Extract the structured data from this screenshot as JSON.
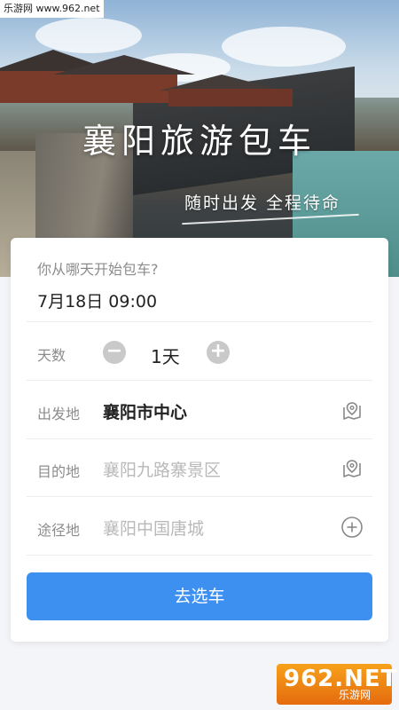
{
  "watermark": {
    "text": "乐游网 www.962.net"
  },
  "hero": {
    "title": "襄阳旅游包车",
    "slogan": "随时出发 全程待命"
  },
  "form": {
    "start_question": "你从哪天开始包车?",
    "start_date": "7月18日  09:00",
    "days_label": "天数",
    "days_value": "1天",
    "minus_label": "−",
    "plus_label": "+",
    "departure_label": "出发地",
    "departure_value": "襄阳市中心",
    "destination_label": "目的地",
    "destination_placeholder": "襄阳九路寨景区",
    "via_label": "途径地",
    "via_placeholder": "襄阳中国唐城",
    "submit_label": "去选车"
  },
  "brand": {
    "big": "962.NET",
    "small": "乐游网"
  },
  "colors": {
    "accent": "#3d8ff0",
    "placeholder": "#b9b9b9",
    "label": "#8c8c8c"
  },
  "icons": {
    "departure": "map-pin-icon",
    "destination": "map-pin-icon",
    "via": "add-circle-icon"
  }
}
